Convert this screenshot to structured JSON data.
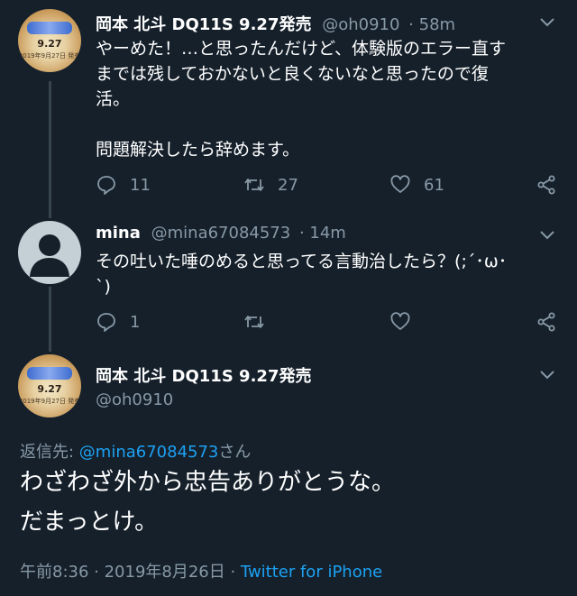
{
  "tweets": [
    {
      "name": "岡本 北斗 DQ11S 9.27発売",
      "handle": "@oh0910",
      "time": "· 58m",
      "lines": [
        "やーめた！…と思ったんだけど、体験版のエラー直す",
        "までは残しておかないと良くないなと思ったので復",
        "活。",
        "",
        "問題解決したら辞めます。"
      ],
      "reply_count": "11",
      "retweet_count": "27",
      "like_count": "61",
      "avatar_date": "9.27",
      "avatar_sub": "2019年9月27日 発売"
    },
    {
      "name": "mina",
      "handle": "@mina67084573",
      "time": "· 14m",
      "lines": [
        "その吐いた唾のめると思ってる言動治したら？(;´･ω･",
        "`)"
      ],
      "reply_count": "1",
      "retweet_count": "",
      "like_count": ""
    }
  ],
  "main_tweet": {
    "name": "岡本 北斗 DQ11S 9.27発売",
    "handle": "@oh0910",
    "reply_prefix": "返信先: ",
    "reply_to": "@mina67084573",
    "reply_suffix": "さん",
    "lines": [
      "わざわざ外から忠告ありがとうな。",
      "だまっとけ。"
    ],
    "timestamp": "午前8:36 · 2019年8月26日 · ",
    "source": "Twitter for iPhone",
    "avatar_date": "9.27",
    "avatar_sub": "2019年9月27日 発売"
  },
  "icons": [
    "chevron-down-icon",
    "reply-icon",
    "retweet-icon",
    "like-icon",
    "share-icon",
    "default-avatar-icon"
  ]
}
